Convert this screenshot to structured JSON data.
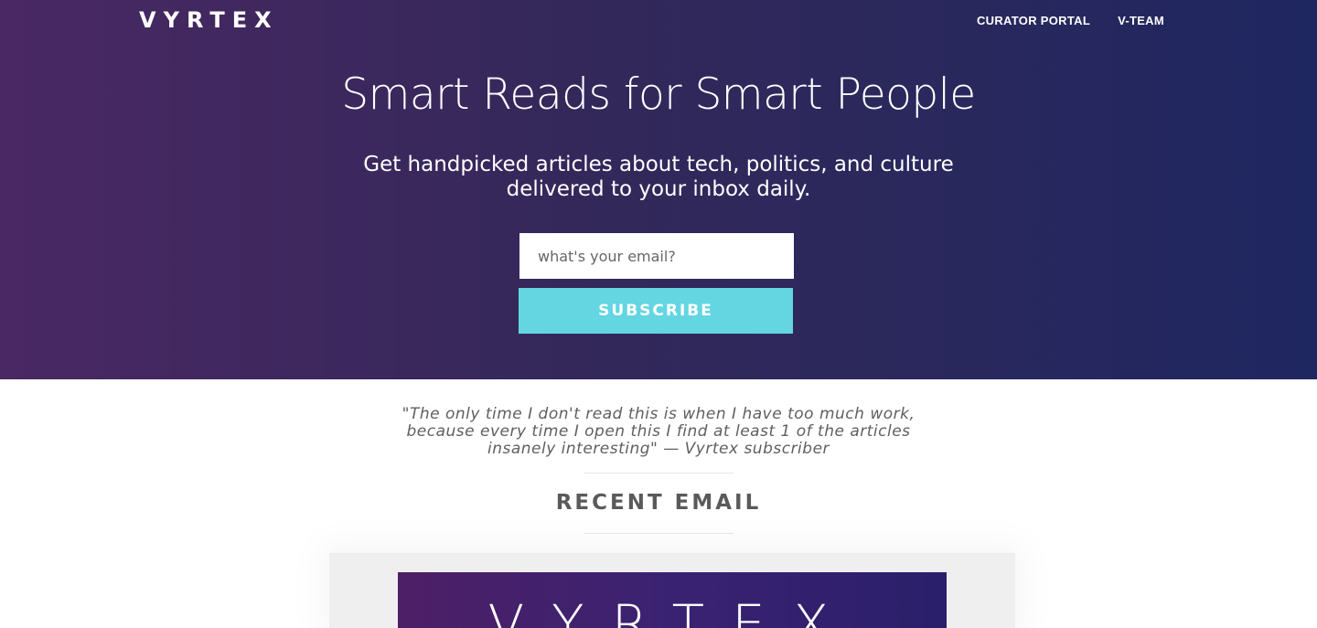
{
  "header": {
    "logo": "VYRTEX",
    "nav": [
      {
        "label": "CURATOR PORTAL"
      },
      {
        "label": "V-TEAM"
      }
    ]
  },
  "hero": {
    "title": "Smart Reads for Smart People",
    "subtitle": "Get handpicked articles about tech, politics, and culture delivered to your inbox daily.",
    "email_placeholder": "what's your email?",
    "subscribe_label": "SUBSCRIBE"
  },
  "testimonial": {
    "text": "\"The only time I don't read this is when I have too much work, because every time I open this I find at least 1 of the articles insanely interesting\" — Vyrtex subscriber"
  },
  "recent": {
    "title": "RECENT EMAIL",
    "preview_logo": "VYRTEX"
  },
  "colors": {
    "hero_start": "#4a2863",
    "hero_end": "#1f2760",
    "accent": "#63d6e2"
  }
}
